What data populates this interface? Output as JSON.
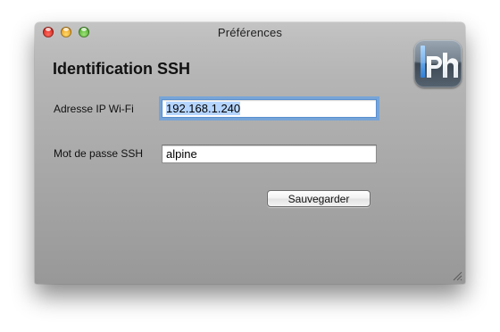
{
  "window": {
    "title": "Préférences"
  },
  "section": {
    "heading": "Identification SSH"
  },
  "app_logo": {
    "text": "iPh",
    "icon": "iphone-app-logo"
  },
  "fields": {
    "ip": {
      "label": "Adresse IP Wi-Fi",
      "value": "192.168.1.240",
      "focused": true,
      "selected": true
    },
    "password": {
      "label": "Mot de passe SSH",
      "value": "alpine"
    }
  },
  "buttons": {
    "save_label": "Sauvegarder"
  },
  "icons": {
    "close": "close-icon",
    "minimize": "minimize-icon",
    "zoom": "zoom-icon",
    "resize": "resize-grip-icon"
  },
  "colors": {
    "close": "#e0443e",
    "minimize": "#dea123",
    "zoom": "#5eb43a",
    "focus_ring": "#6ca2de",
    "selection": "#b5d5ff"
  }
}
